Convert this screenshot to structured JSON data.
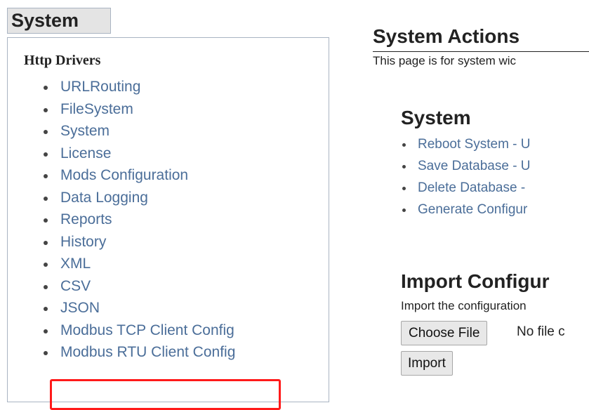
{
  "sidebar": {
    "tab_label": "System",
    "heading": "Http Drivers",
    "items": [
      {
        "label": "URLRouting"
      },
      {
        "label": "FileSystem"
      },
      {
        "label": "System"
      },
      {
        "label": "License"
      },
      {
        "label": "Mods Configuration"
      },
      {
        "label": "Data Logging"
      },
      {
        "label": "Reports"
      },
      {
        "label": "History"
      },
      {
        "label": "XML"
      },
      {
        "label": "CSV"
      },
      {
        "label": "JSON"
      },
      {
        "label": "Modbus TCP Client Config"
      },
      {
        "label": "Modbus RTU Client Config"
      }
    ],
    "highlighted_item": "Modbus RTU Client Config",
    "highlight_color": "#ff1a1a"
  },
  "main": {
    "title": "System Actions",
    "description": "This page is for system wic",
    "system_section": {
      "title": "System",
      "actions": [
        {
          "label": "Reboot System - U"
        },
        {
          "label": "Save Database - U"
        },
        {
          "label": "Delete Database -"
        },
        {
          "label": "Generate Configur"
        }
      ]
    },
    "import_section": {
      "title": "Import Configur",
      "description": "Import the configuration",
      "choose_file_label": "Choose File",
      "no_file_text": "No file c",
      "import_label": "Import"
    }
  },
  "colors": {
    "link": "#4b6e99",
    "border": "#a9b4c2",
    "tab_background": "#e4e4e4"
  }
}
